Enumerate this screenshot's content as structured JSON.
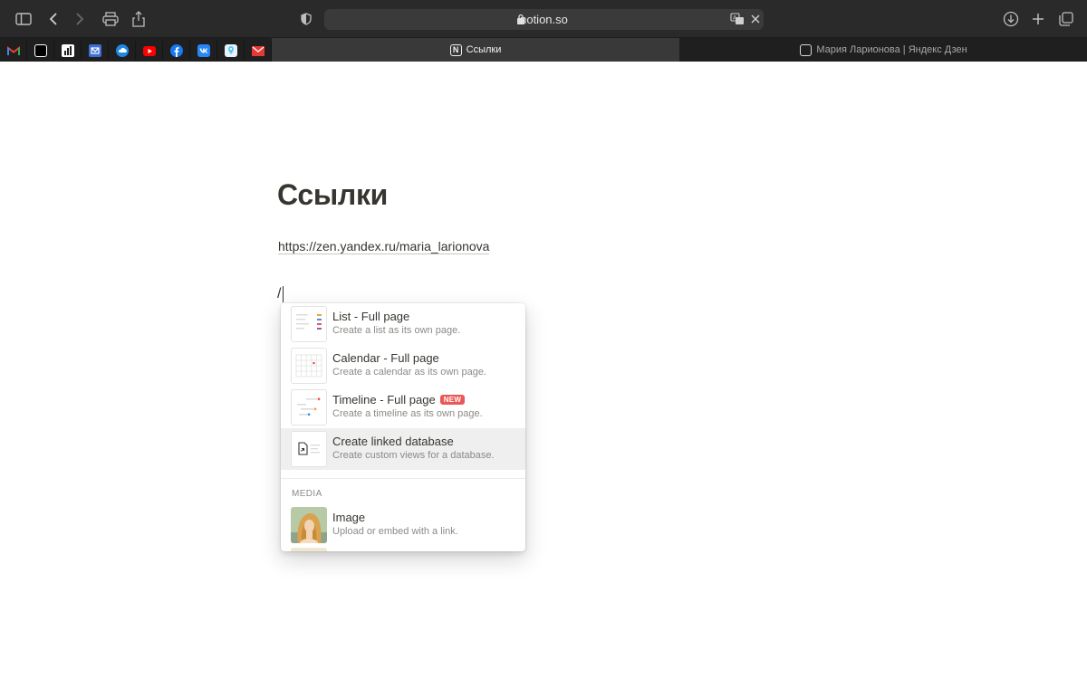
{
  "browser": {
    "url": "notion.so",
    "bookmarks": [
      {
        "name": "gmail-bookmark-icon",
        "color": "#ea4335"
      },
      {
        "name": "notion-bookmark-icon",
        "color": "#ffffff"
      },
      {
        "name": "stats-bookmark-icon",
        "color": "#ffffff"
      },
      {
        "name": "mail-bookmark-icon",
        "color": "#3b6fd8"
      },
      {
        "name": "cloud-bookmark-icon",
        "color": "#1e88e5"
      },
      {
        "name": "youtube-bookmark-icon",
        "color": "#ff0000"
      },
      {
        "name": "facebook-bookmark-icon",
        "color": "#1877f2"
      },
      {
        "name": "vk-bookmark-icon",
        "color": "#2787f5"
      },
      {
        "name": "maps-bookmark-icon",
        "color": "#5ac8fa"
      },
      {
        "name": "envelope-bookmark-icon",
        "color": "#e53935"
      }
    ],
    "tabs": [
      {
        "label": "Ссылки"
      },
      {
        "label": "Мария Ларионова | Яндекс Дзен"
      }
    ]
  },
  "page": {
    "title": "Ссылки",
    "link": "https://zen.yandex.ru/maria_larionova",
    "slash": "/"
  },
  "menu": {
    "items": [
      {
        "title": "List - Full page",
        "desc": "Create a list as its own page."
      },
      {
        "title": "Calendar - Full page",
        "desc": "Create a calendar as its own page."
      },
      {
        "title": "Timeline - Full page",
        "desc": "Create a timeline as its own page.",
        "badge": "NEW"
      },
      {
        "title": "Create linked database",
        "desc": "Create custom views for a database."
      }
    ],
    "section": "MEDIA",
    "media": {
      "title": "Image",
      "desc": "Upload or embed with a link."
    }
  }
}
